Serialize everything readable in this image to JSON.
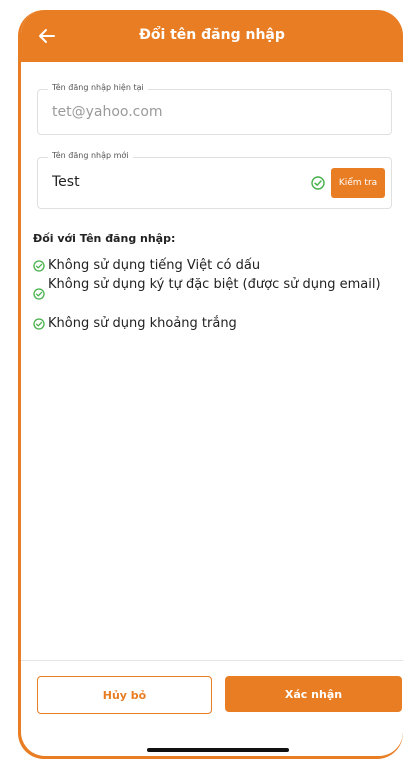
{
  "header": {
    "title": "Đổi tên đăng nhập",
    "back_icon": "arrow-left-icon"
  },
  "form": {
    "current_username": {
      "label": "Tên đăng nhập hiện tại",
      "value": "tet@yahoo.com"
    },
    "new_username": {
      "label": "Tên đăng nhập mới",
      "value": "Test",
      "valid_icon": "check-circle-icon",
      "check_button_label": "Kiểm tra"
    }
  },
  "rules": {
    "title": "Đối với Tên đăng nhập:",
    "items": [
      "Không sử dụng tiếng Việt có dấu",
      "Không sử dụng ký tự đặc biệt (được sử dụng email)",
      "Không sử dụng khoảng trắng"
    ]
  },
  "footer": {
    "cancel_label": "Hủy bỏ",
    "confirm_label": "Xác nhận"
  },
  "colors": {
    "accent": "#e97d23",
    "success": "#46b04a"
  }
}
